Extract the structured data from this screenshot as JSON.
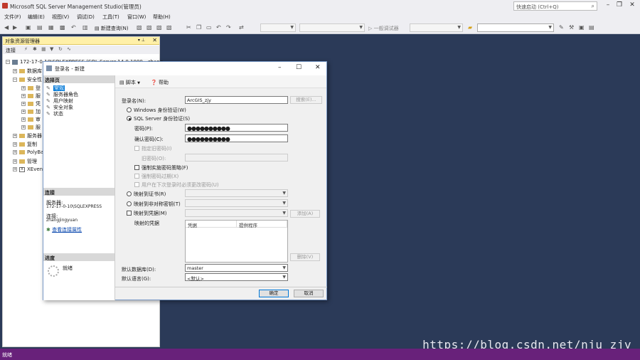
{
  "app": {
    "title": "Microsoft SQL Server Management Studio(管理员)",
    "quick_launch": "快速启动 (Ctrl+Q)"
  },
  "menu": [
    "文件(F)",
    "编辑(E)",
    "视图(V)",
    "调试(D)",
    "工具(T)",
    "窗口(W)",
    "帮助(H)"
  ],
  "toolbar": {
    "new_query": "新建查询(N)",
    "debugger": "一般调试器"
  },
  "object_explorer": {
    "title": "对象资源管理器",
    "connect": "连接",
    "server": "172-17-0-10\\SQLEXPRESS (SQL Server 14.0.1000 - zhang",
    "nodes": [
      "数据库",
      "安全性",
      "服务器",
      "复制",
      "PolyBase",
      "管理",
      "XEvent"
    ],
    "security_children": [
      "登",
      "服",
      "凭",
      "加",
      "审",
      "服"
    ]
  },
  "dialog": {
    "title": "登录名 - 新建",
    "select_page": "选择页",
    "pages": [
      "常规",
      "服务器角色",
      "用户映射",
      "安全对象",
      "状态"
    ],
    "script": "脚本",
    "help": "帮助",
    "login_name_label": "登录名(N):",
    "login_name_value": "ArcGIS_zjy",
    "search_button": "搜索(E)...",
    "windows_auth": "Windows 身份验证(W)",
    "sql_auth": "SQL Server 身份验证(S)",
    "password_label": "密码(P):",
    "password_value": "●●●●●●●●●●",
    "confirm_label": "确认密码(C):",
    "confirm_value": "●●●●●●●●●●",
    "specify_old": "指定旧密码(I)",
    "old_password": "旧密码(O):",
    "enforce_policy": "强制实施密码策略(F)",
    "enforce_expiration": "强制密码过期(X)",
    "must_change": "用户在下次登录时必须更改密码(U)",
    "map_cert": "映射到证书(R)",
    "map_asym": "映射到非对称密钥(T)",
    "map_cred": "映射到凭据(M)",
    "add_button": "添加(A)",
    "mapped_creds": "映射的凭据",
    "cred_cols": [
      "凭据",
      "提供程序"
    ],
    "remove_button": "删除(V)",
    "default_db_label": "默认数据库(D):",
    "default_db": "master",
    "default_lang_label": "默认语言(G):",
    "default_lang": "<默认>",
    "connection_hdr": "连接",
    "server_label": "服务器:",
    "server_value": "172-17-0-10\\SQLEXPRESS",
    "conn_label": "连接:",
    "conn_value": "zhangjingyuan",
    "view_props": "查看连接属性",
    "progress_hdr": "进度",
    "ready": "就绪",
    "ok": "确定",
    "cancel": "取消"
  },
  "status": "就绪",
  "watermark": "https://blog.csdn.net/nju_zjy"
}
